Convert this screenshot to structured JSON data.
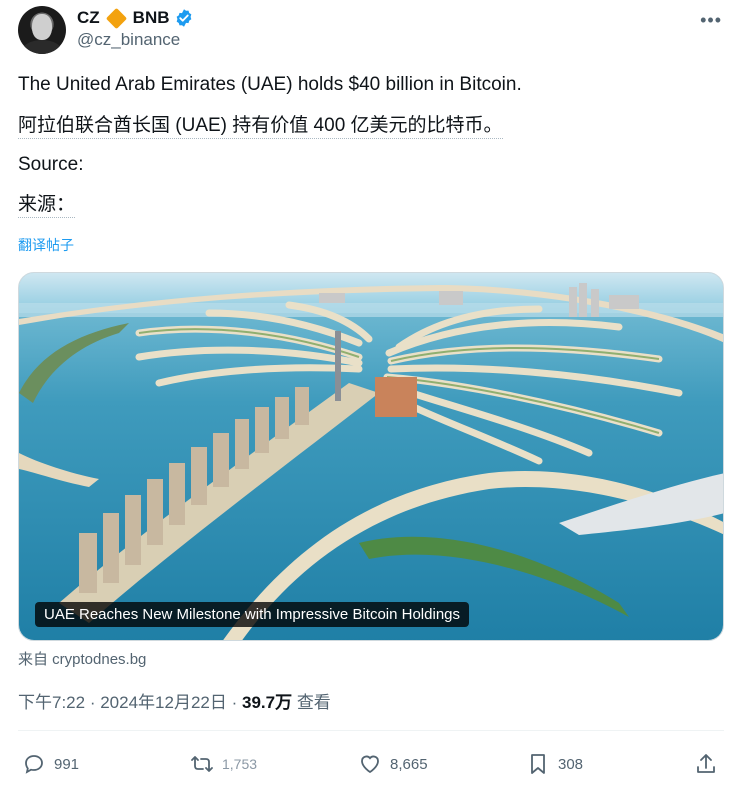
{
  "author": {
    "display_name": "CZ",
    "ticker": "BNB",
    "handle": "@cz_binance",
    "verified": true,
    "avatar_icon": "avatar-portrait",
    "badge_color": "#f3a20f",
    "verified_color": "#1d9bf0"
  },
  "post": {
    "line1": "The United Arab Emirates (UAE) holds $40 billion in Bitcoin.",
    "line2": "阿拉伯联合酋长国 (UAE) 持有价值 400 亿美元的比特币。",
    "line3": "Source:",
    "line4": "来源：",
    "translate_label": "翻译帖子"
  },
  "card": {
    "caption": "UAE Reaches New Milestone with Impressive Bitcoin Holdings",
    "source": "来自 cryptodnes.bg"
  },
  "meta": {
    "time": "下午7:22",
    "date": "2024年12月22日",
    "views": "39.7万",
    "views_label": "查看"
  },
  "actions": {
    "replies": "991",
    "reposts": "1,753",
    "likes": "8,665",
    "bookmarks": "308"
  },
  "colors": {
    "link": "#1d9bf0",
    "muted": "#536471",
    "text": "#0f1419"
  }
}
